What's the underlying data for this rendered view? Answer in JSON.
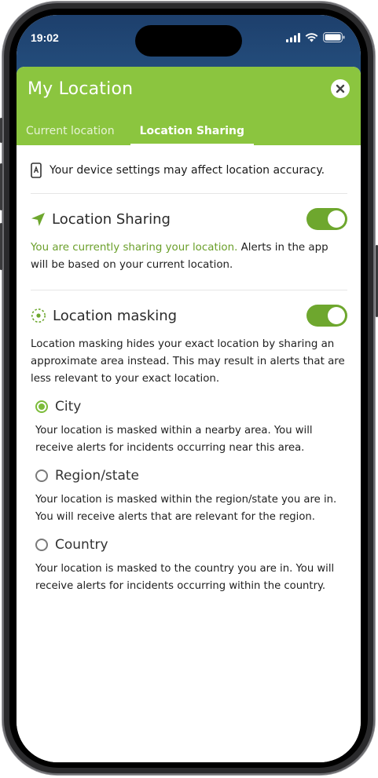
{
  "status_bar": {
    "time": "19:02"
  },
  "sheet": {
    "title": "My Location",
    "tabs": [
      {
        "label": "Current location",
        "active": false
      },
      {
        "label": "Location Sharing",
        "active": true
      }
    ]
  },
  "notice": {
    "text": "Your device settings may affect location accuracy."
  },
  "sharing": {
    "title": "Location Sharing",
    "enabled": true,
    "status_text": "You are currently sharing your location.",
    "desc_text": " Alerts in the app will be based on your current location."
  },
  "masking": {
    "title": "Location masking",
    "enabled": true,
    "desc": "Location masking hides your exact location by sharing an approximate area instead. This may result in alerts that are less relevant to your exact location.",
    "options": [
      {
        "label": "City",
        "selected": true,
        "desc": "Your location is masked within a nearby area. You will receive alerts for incidents occurring near this area."
      },
      {
        "label": "Region/state",
        "selected": false,
        "desc": "Your location is masked within the region/state you are in. You will receive alerts that are relevant for the region."
      },
      {
        "label": "Country",
        "selected": false,
        "desc": "Your location is masked to the country you are in. You will receive alerts for incidents occurring within the country."
      }
    ]
  },
  "colors": {
    "accent": "#8bc53f",
    "toggle_on": "#6ea72e",
    "status_bar": "#1d3f6c"
  },
  "icons": {
    "notice": "phone-icon",
    "sharing": "location-arrow-icon",
    "masking": "masking-target-icon",
    "close": "close-icon"
  }
}
